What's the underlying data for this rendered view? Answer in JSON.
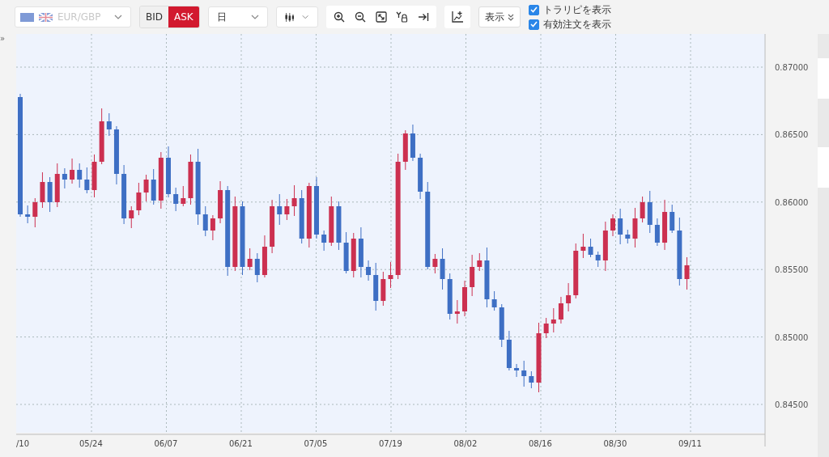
{
  "toolbar": {
    "symbol": {
      "value": "EUR/GBP",
      "disabled": true
    },
    "price_side": [
      {
        "label": "BID",
        "selected": false
      },
      {
        "label": "ASK",
        "selected": true
      }
    ],
    "period": {
      "value": "日"
    },
    "display_button": {
      "label": "表示"
    },
    "options": [
      {
        "label": "トラリピを表示",
        "checked": true
      },
      {
        "label": "有効注文を表示",
        "checked": true
      }
    ]
  },
  "chart": {
    "collapse_toggle": "»",
    "y_labels": [
      "0.87000",
      "0.86500",
      "0.86000",
      "0.85500",
      "0.85000",
      "0.84500"
    ],
    "x_labels": [
      "/10",
      "05/24",
      "06/07",
      "06/21",
      "07/05",
      "07/19",
      "08/02",
      "08/16",
      "08/30",
      "09/11"
    ]
  }
}
